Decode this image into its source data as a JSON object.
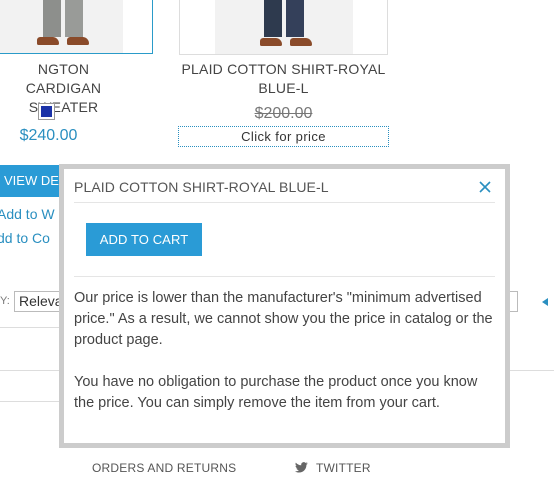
{
  "products": [
    {
      "name": "NGTON CARDIGAN SWEATER",
      "name_lines": [
        "NGTON CARDIGAN",
        "SWEATER"
      ],
      "price": "$240.00",
      "swatch_color": "#1c33a8",
      "view_label": "VIEW DE",
      "links": [
        "Add to W",
        "dd to Co"
      ]
    },
    {
      "name": "PLAID COTTON SHIRT-ROYAL BLUE-L",
      "name_lines": [
        "PLAID COTTON SHIRT-ROYAL",
        "BLUE-L"
      ],
      "old_price": "$200.00",
      "click_price_label": "Click for price"
    }
  ],
  "toolbar": {
    "sort_label": "Y:",
    "sort_value": "Releva"
  },
  "modal": {
    "title": "PLAID COTTON SHIRT-ROYAL BLUE-L",
    "add_to_cart_label": "ADD TO CART",
    "paragraphs": [
      "Our price is lower than the manufacturer's \"minimum advertised price.\" As a result, we cannot show you the price in catalog or the product page.",
      "You have no obligation to purchase the product once you know the price. You can simply remove the item from your cart."
    ]
  },
  "footer": {
    "orders_label": "ORDERS AND RETURNS",
    "twitter_label": "TWITTER"
  },
  "colors": {
    "accent": "#2a9bd6",
    "link": "#2a8fc0",
    "modal_border": "#cccccc"
  }
}
